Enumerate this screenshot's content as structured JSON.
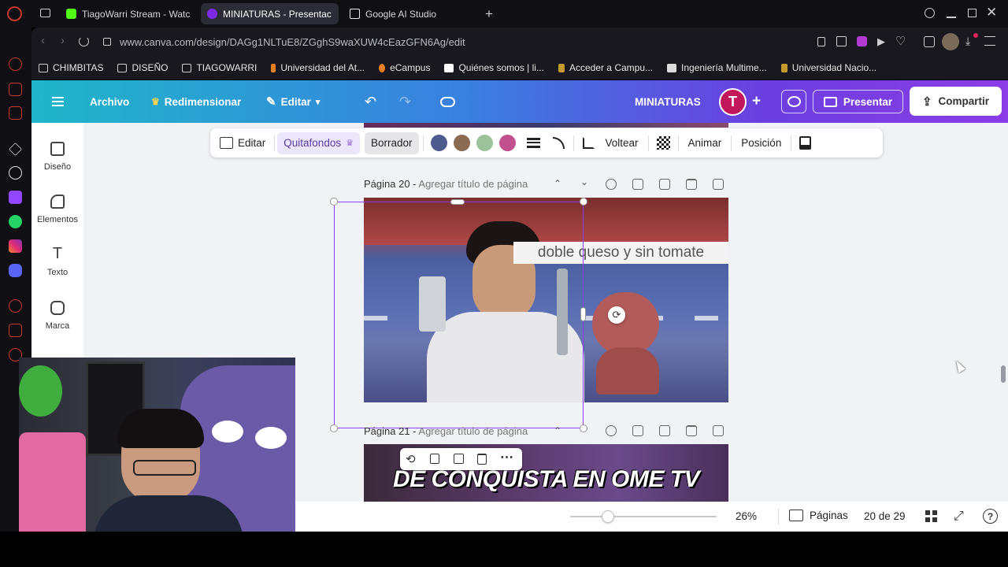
{
  "tabs": [
    {
      "label": "TiagoWarri Stream - Watc",
      "favicon_color": "#53fc18"
    },
    {
      "label": "MINIATURAS - Presentac",
      "favicon_color": "#7d2ae8"
    },
    {
      "label": "Google AI Studio",
      "favicon_color": "#e8eaed"
    }
  ],
  "address": {
    "url": "www.canva.com/design/DAGg1NLTuE8/ZGghS9waXUW4cEazGFN6Ag/edit"
  },
  "bookmarks": [
    "CHIMBITAS",
    "DISEÑO",
    "TIAGOWARRI",
    "Universidad del At...",
    "eCampus",
    "Quiénes somos | li...",
    "Acceder a Campu...",
    "Ingeniería Multime...",
    "Universidad Nacio..."
  ],
  "header": {
    "archivo": "Archivo",
    "redimensionar": "Redimensionar",
    "editar": "Editar",
    "title": "MINIATURAS",
    "avatar_letter": "T",
    "presentar": "Presentar",
    "compartir": "Compartir",
    "avatar_color": "#c2185b"
  },
  "sidebar": {
    "items": [
      {
        "label": "Diseño",
        "icon": "layout-icon"
      },
      {
        "label": "Elementos",
        "icon": "elements-icon"
      },
      {
        "label": "Texto",
        "icon": "text-icon"
      },
      {
        "label": "Marca",
        "icon": "brand-icon"
      }
    ]
  },
  "toolbar": {
    "editar": "Editar",
    "quitafondos": "Quitafondos",
    "borrador": "Borrador",
    "colors": [
      "#4d5a8c",
      "#8a6a52",
      "#9bc29b",
      "#c2508f"
    ],
    "voltear": "Voltear",
    "animar": "Animar",
    "posicion": "Posición"
  },
  "pages": [
    {
      "label": "Página 20 -",
      "title_placeholder": "Agregar título de página",
      "caption": "doble queso y sin tomate"
    },
    {
      "label": "Página 21 -",
      "title_placeholder": "Agregar título de página",
      "caption": "DE CONQUISTA EN OME TV"
    }
  ],
  "bottom": {
    "zoom": "26%",
    "paginas": "Páginas",
    "page_counter": "20 de 29",
    "zoom_fraction": 0.26
  }
}
